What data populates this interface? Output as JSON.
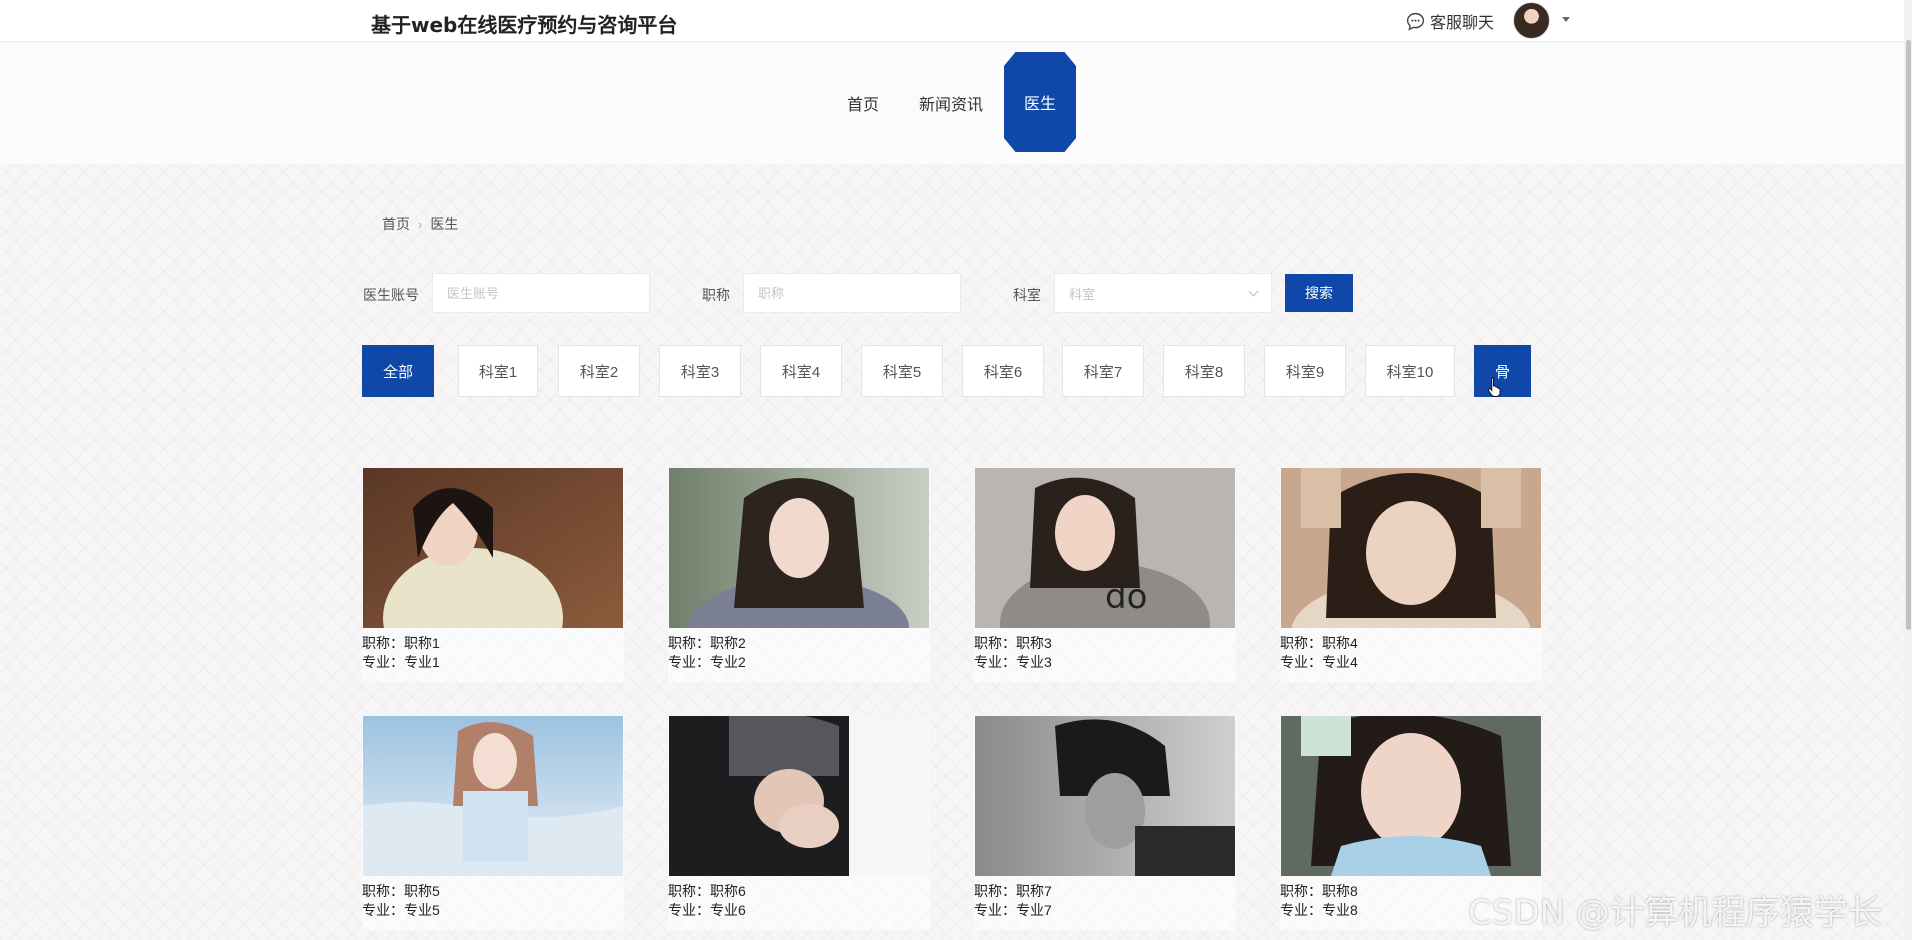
{
  "header": {
    "site_title": "基于web在线医疗预约与咨询平台",
    "chat_label": "客服聊天"
  },
  "nav": {
    "items": [
      {
        "label": "首页"
      },
      {
        "label": "新闻资讯"
      },
      {
        "label": "医生",
        "active": true
      }
    ]
  },
  "breadcrumb": {
    "home": "首页",
    "current": "医生"
  },
  "search": {
    "account_label": "医生账号",
    "account_placeholder": "医生账号",
    "title_label": "职称",
    "title_placeholder": "职称",
    "dept_label": "科室",
    "dept_placeholder": "科室",
    "button": "搜索"
  },
  "departments": [
    "全部",
    "科室1",
    "科室2",
    "科室3",
    "科室4",
    "科室5",
    "科室6",
    "科室7",
    "科室8",
    "科室9",
    "科室10",
    "骨"
  ],
  "active_department": "骨",
  "doctors": [
    {
      "title": "职称：职称1",
      "specialty": "专业：专业1"
    },
    {
      "title": "职称：职称2",
      "specialty": "专业：专业2"
    },
    {
      "title": "职称：职称3",
      "specialty": "专业：专业3"
    },
    {
      "title": "职称：职称4",
      "specialty": "专业：专业4"
    },
    {
      "title": "职称：职称5",
      "specialty": "专业：专业5"
    },
    {
      "title": "职称：职称6",
      "specialty": "专业：专业6"
    },
    {
      "title": "职称：职称7",
      "specialty": "专业：专业7"
    },
    {
      "title": "职称：职称8",
      "specialty": "专业：专业8"
    }
  ],
  "watermark": "CSDN @计算机程序猿学长",
  "colors": {
    "accent": "#0f48a8"
  }
}
